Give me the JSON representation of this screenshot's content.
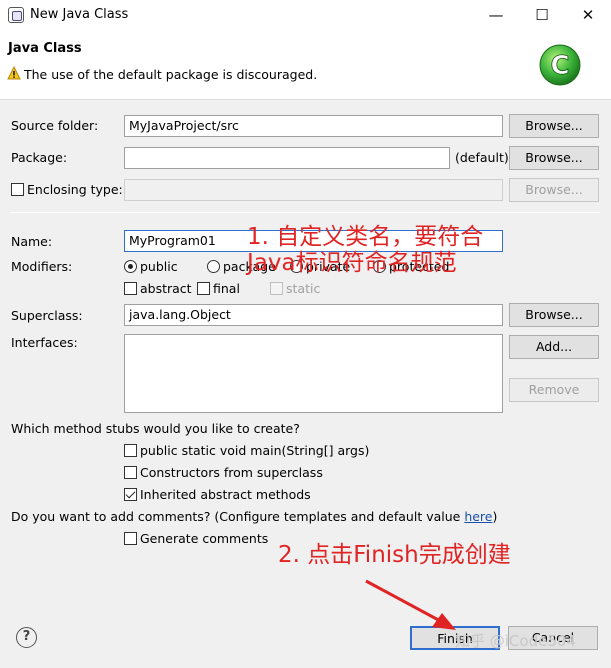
{
  "window": {
    "title": "New Java Class",
    "minimize": "—",
    "maximize": "☐",
    "close": "✕"
  },
  "header": {
    "title": "Java Class",
    "message": "The use of the default package is discouraged.",
    "icon_name": "warning-icon",
    "logo_letter": "C"
  },
  "form": {
    "source_folder": {
      "label": "Source folder:",
      "value": "MyJavaProject/src",
      "button": "Browse..."
    },
    "package": {
      "label": "Package:",
      "value": "",
      "default_text": "(default)",
      "button": "Browse..."
    },
    "enclosing_type": {
      "label": "Enclosing type:",
      "checked": false,
      "value": "",
      "button": "Browse..."
    },
    "name": {
      "label": "Name:",
      "value": "MyProgram01"
    },
    "modifiers": {
      "label": "Modifiers:",
      "access": [
        "public",
        "package",
        "private",
        "protected"
      ],
      "selected": "public",
      "abstract": "abstract",
      "final": "final",
      "static": "static"
    },
    "superclass": {
      "label": "Superclass:",
      "value": "java.lang.Object",
      "button": "Browse..."
    },
    "interfaces": {
      "label": "Interfaces:",
      "add_button": "Add...",
      "remove_button": "Remove"
    },
    "stubs": {
      "question": "Which method stubs would you like to create?",
      "main": {
        "label": "public static void main(String[] args)",
        "checked": false
      },
      "constructors": {
        "label": "Constructors from superclass",
        "checked": false
      },
      "inherited": {
        "label": "Inherited abstract methods",
        "checked": true
      }
    },
    "comments": {
      "question": "Do you want to add comments? (Configure templates and default value ",
      "link": "here",
      "question_end": ")",
      "generate": {
        "label": "Generate comments",
        "checked": false
      }
    }
  },
  "annotations": {
    "step1_line1": "1. 自定义类名，要符合",
    "step1_line2": "Java标识符命名规范",
    "step2": "2. 点击Finish完成创建"
  },
  "footer": {
    "help": "?",
    "finish": "Finish",
    "cancel": "Cancel",
    "watermark": "知乎 @iCode504"
  },
  "colors": {
    "annotation": "#e02424",
    "link": "#1a4fa8",
    "logo": "#3bb43b"
  }
}
